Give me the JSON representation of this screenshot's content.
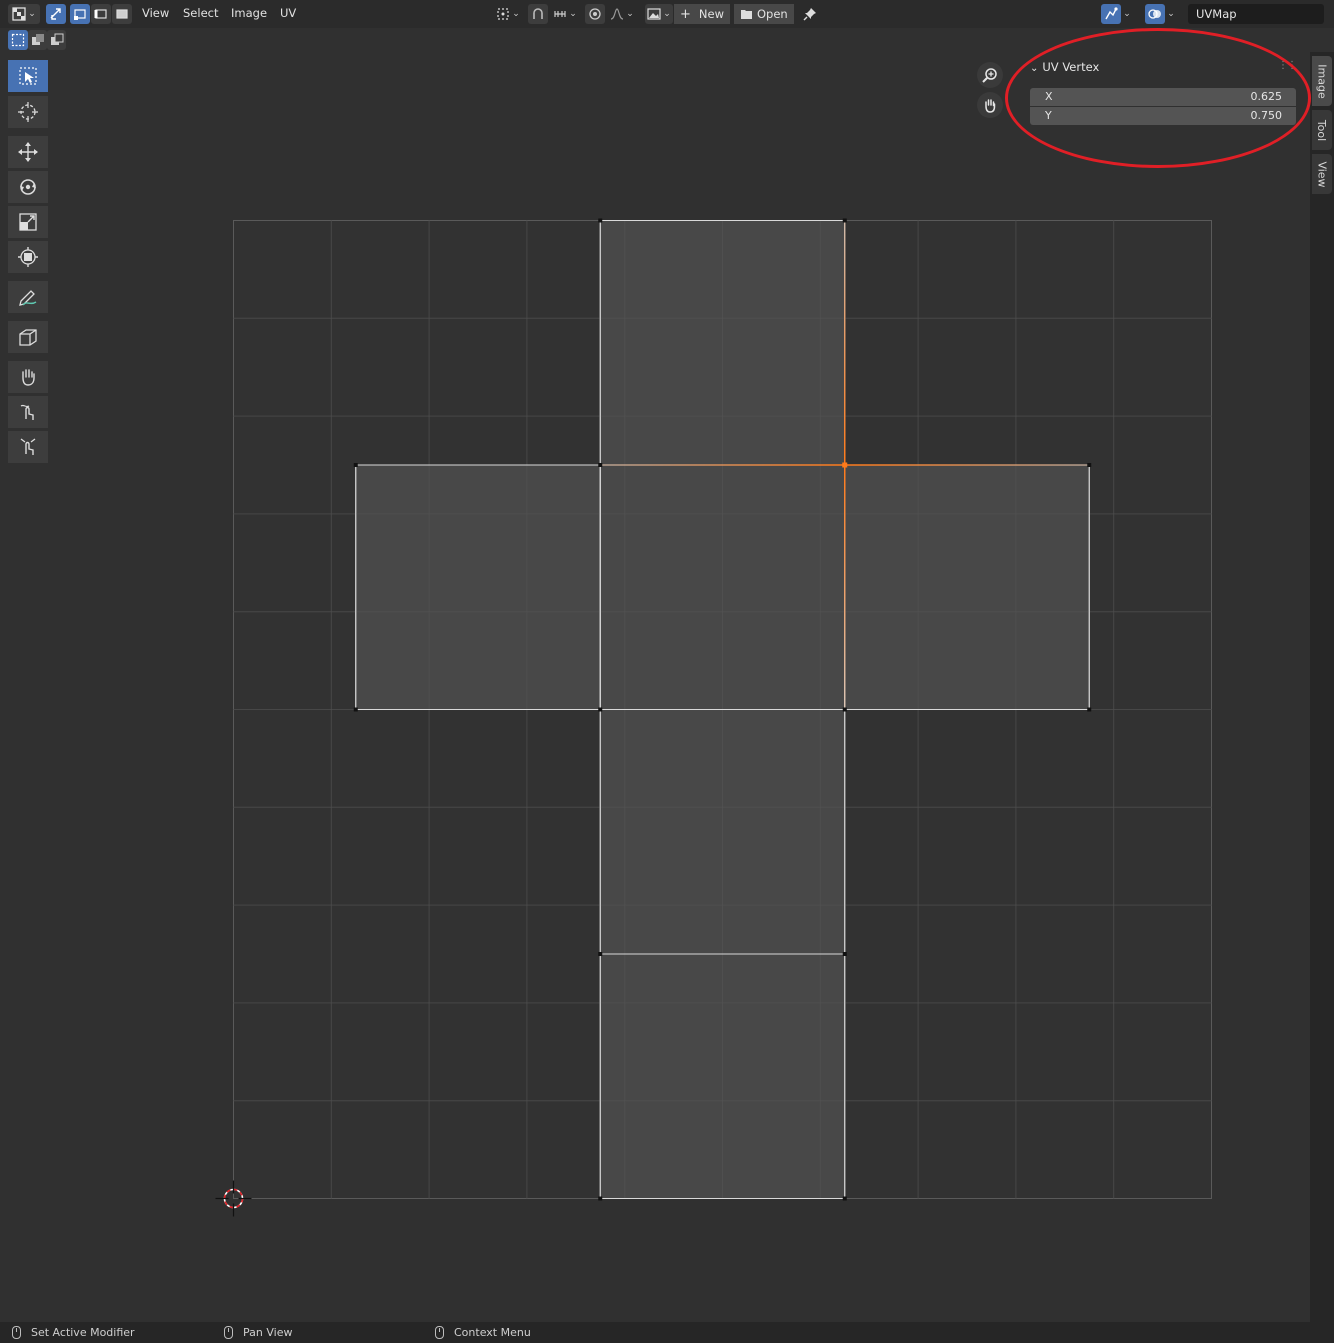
{
  "header": {
    "menus": [
      "View",
      "Select",
      "Image",
      "UV"
    ],
    "new_label": "New",
    "open_label": "Open",
    "uvmap_name": "UVMap",
    "icons": [
      "editor-type-icon",
      "sync-selection-icon",
      "vertex-select-icon",
      "edge-select-icon",
      "face-select-icon",
      "pivot-icon",
      "snap-icon",
      "snap-target-icon",
      "proportional-editing-icon",
      "falloff-icon",
      "image-browse-icon",
      "plus-icon",
      "folder-icon",
      "pin-icon",
      "overlay-icon",
      "gizmo-icon"
    ]
  },
  "subheader": {
    "icons": [
      "select-box-mode-icon",
      "select-extend-icon",
      "select-subtract-icon"
    ]
  },
  "toolbar": {
    "tools": [
      "select-box-tool",
      "cursor-tool",
      "move-tool",
      "rotate-tool",
      "scale-tool",
      "transform-tool",
      "annotate-tool",
      "rip-region-tool",
      "grab-tool",
      "relax-tool",
      "pinch-tool"
    ]
  },
  "navigation": {
    "icons": [
      "zoom-icon",
      "pan-hand-icon"
    ]
  },
  "sidebar": {
    "panel_title": "UV Vertex",
    "x_label": "X",
    "x_value": "0.625",
    "y_label": "Y",
    "y_value": "0.750",
    "tabs": [
      "Image",
      "Tool",
      "View"
    ],
    "active_tab": "Image"
  },
  "uv_editor": {
    "grid_divisions": 10,
    "selected_vertex": [
      0.625,
      0.75
    ],
    "faces": [
      [
        [
          0.375,
          0.75
        ],
        [
          0.625,
          0.75
        ],
        [
          0.625,
          1.0
        ],
        [
          0.375,
          1.0
        ]
      ],
      [
        [
          0.125,
          0.5
        ],
        [
          0.375,
          0.5
        ],
        [
          0.375,
          0.75
        ],
        [
          0.125,
          0.75
        ]
      ],
      [
        [
          0.375,
          0.5
        ],
        [
          0.625,
          0.5
        ],
        [
          0.625,
          0.75
        ],
        [
          0.375,
          0.75
        ]
      ],
      [
        [
          0.625,
          0.5
        ],
        [
          0.875,
          0.5
        ],
        [
          0.875,
          0.75
        ],
        [
          0.625,
          0.75
        ]
      ],
      [
        [
          0.375,
          0.25
        ],
        [
          0.625,
          0.25
        ],
        [
          0.625,
          0.5
        ],
        [
          0.375,
          0.5
        ]
      ],
      [
        [
          0.375,
          0.0
        ],
        [
          0.625,
          0.0
        ],
        [
          0.625,
          0.25
        ],
        [
          0.375,
          0.25
        ]
      ]
    ],
    "colors": {
      "face_fill": "#4c4c4c",
      "edge": "#d9d9d9",
      "selected": "#ff7a1a",
      "grid_line": "#3e3e3e",
      "bounds": "#5a5a5a",
      "cursor": "#e01f26"
    }
  },
  "statusbar": {
    "left_click": "Set Active Modifier",
    "middle_click": "Pan View",
    "right_click": "Context Menu"
  },
  "highlight": {
    "color": "#e01f26",
    "target": "UV Vertex panel"
  }
}
